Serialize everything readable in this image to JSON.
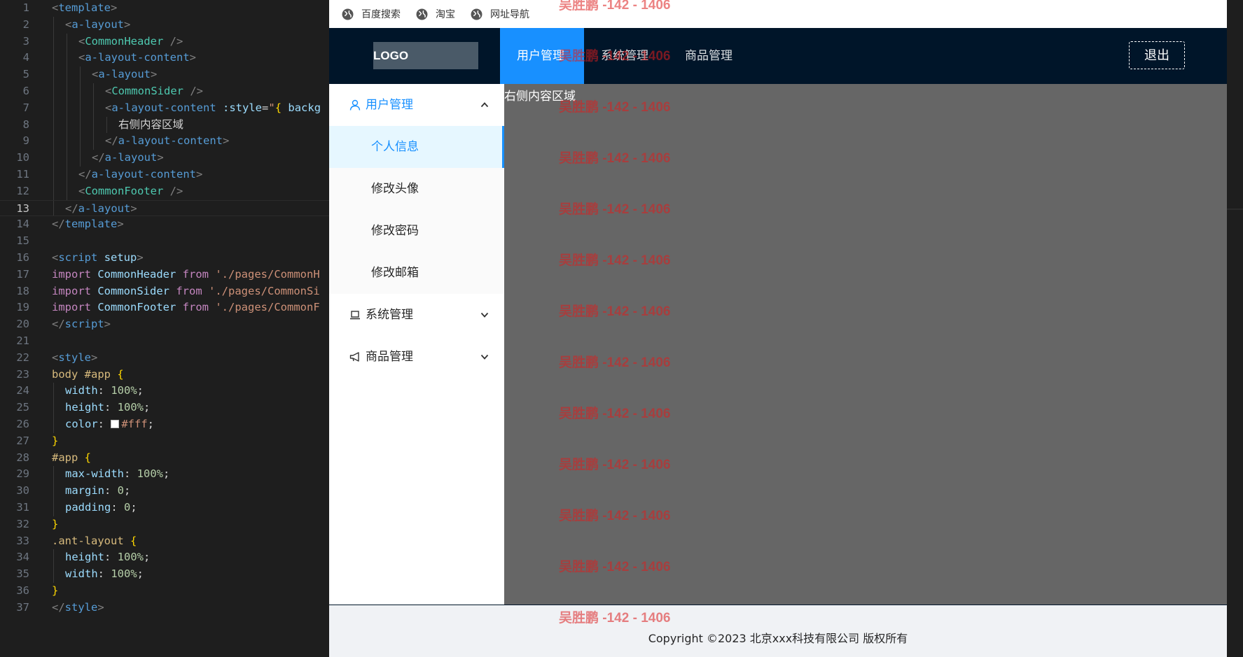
{
  "editor": {
    "lines": [
      {
        "n": "1",
        "indent": 0,
        "tokens": [
          [
            "t-pun",
            "<"
          ],
          [
            "t-tag",
            "template"
          ],
          [
            "t-pun",
            ">"
          ]
        ]
      },
      {
        "n": "2",
        "indent": 1,
        "tokens": [
          [
            "t-pun",
            "<"
          ],
          [
            "t-tag",
            "a-layout"
          ],
          [
            "t-pun",
            ">"
          ]
        ]
      },
      {
        "n": "3",
        "indent": 2,
        "tokens": [
          [
            "t-pun",
            "<"
          ],
          [
            "t-cmp",
            "CommonHeader"
          ],
          [
            "t-pln",
            " "
          ],
          [
            "t-pun",
            "/>"
          ]
        ]
      },
      {
        "n": "4",
        "indent": 2,
        "tokens": [
          [
            "t-pun",
            "<"
          ],
          [
            "t-tag",
            "a-layout-content"
          ],
          [
            "t-pun",
            ">"
          ]
        ]
      },
      {
        "n": "5",
        "indent": 3,
        "tokens": [
          [
            "t-pun",
            "<"
          ],
          [
            "t-tag",
            "a-layout"
          ],
          [
            "t-pun",
            ">"
          ]
        ]
      },
      {
        "n": "6",
        "indent": 4,
        "tokens": [
          [
            "t-pun",
            "<"
          ],
          [
            "t-cmp",
            "CommonSider"
          ],
          [
            "t-pln",
            " "
          ],
          [
            "t-pun",
            "/>"
          ]
        ]
      },
      {
        "n": "7",
        "indent": 4,
        "tokens": [
          [
            "t-pun",
            "<"
          ],
          [
            "t-tag",
            "a-layout-content"
          ],
          [
            "t-pln",
            " "
          ],
          [
            "t-att",
            ":style"
          ],
          [
            "t-pln",
            "="
          ],
          [
            "t-str",
            "\""
          ],
          [
            "t-brk",
            "{"
          ],
          [
            "t-pln",
            " "
          ],
          [
            "t-att",
            "backg"
          ]
        ]
      },
      {
        "n": "8",
        "indent": 5,
        "tokens": [
          [
            "t-txt",
            "右侧内容区域"
          ]
        ]
      },
      {
        "n": "9",
        "indent": 4,
        "tokens": [
          [
            "t-pun",
            "</"
          ],
          [
            "t-tag",
            "a-layout-content"
          ],
          [
            "t-pun",
            ">"
          ]
        ]
      },
      {
        "n": "10",
        "indent": 3,
        "tokens": [
          [
            "t-pun",
            "</"
          ],
          [
            "t-tag",
            "a-layout"
          ],
          [
            "t-pun",
            ">"
          ]
        ]
      },
      {
        "n": "11",
        "indent": 2,
        "tokens": [
          [
            "t-pun",
            "</"
          ],
          [
            "t-tag",
            "a-layout-content"
          ],
          [
            "t-pun",
            ">"
          ]
        ]
      },
      {
        "n": "12",
        "indent": 2,
        "tokens": [
          [
            "t-pun",
            "<"
          ],
          [
            "t-cmp",
            "CommonFooter"
          ],
          [
            "t-pln",
            " "
          ],
          [
            "t-pun",
            "/>"
          ]
        ]
      },
      {
        "n": "13",
        "indent": 1,
        "tokens": [
          [
            "t-pun",
            "</"
          ],
          [
            "t-tag",
            "a-layout"
          ],
          [
            "t-pun",
            ">"
          ]
        ]
      },
      {
        "n": "14",
        "indent": 0,
        "tokens": [
          [
            "t-pun",
            "</"
          ],
          [
            "t-tag",
            "template"
          ],
          [
            "t-pun",
            ">"
          ]
        ]
      },
      {
        "n": "15",
        "indent": 0,
        "tokens": []
      },
      {
        "n": "16",
        "indent": 0,
        "tokens": [
          [
            "t-pun",
            "<"
          ],
          [
            "t-tag",
            "script"
          ],
          [
            "t-pln",
            " "
          ],
          [
            "t-att",
            "setup"
          ],
          [
            "t-pun",
            ">"
          ]
        ]
      },
      {
        "n": "17",
        "indent": 0,
        "tokens": [
          [
            "t-kw",
            "import"
          ],
          [
            "t-pln",
            " "
          ],
          [
            "t-id",
            "CommonHeader"
          ],
          [
            "t-pln",
            " "
          ],
          [
            "t-kw",
            "from"
          ],
          [
            "t-pln",
            " "
          ],
          [
            "t-str",
            "'./pages/CommonH"
          ]
        ]
      },
      {
        "n": "18",
        "indent": 0,
        "tokens": [
          [
            "t-kw",
            "import"
          ],
          [
            "t-pln",
            " "
          ],
          [
            "t-id",
            "CommonSider"
          ],
          [
            "t-pln",
            " "
          ],
          [
            "t-kw",
            "from"
          ],
          [
            "t-pln",
            " "
          ],
          [
            "t-str",
            "'./pages/CommonSi"
          ]
        ]
      },
      {
        "n": "19",
        "indent": 0,
        "tokens": [
          [
            "t-kw",
            "import"
          ],
          [
            "t-pln",
            " "
          ],
          [
            "t-id",
            "CommonFooter"
          ],
          [
            "t-pln",
            " "
          ],
          [
            "t-kw",
            "from"
          ],
          [
            "t-pln",
            " "
          ],
          [
            "t-str",
            "'./pages/CommonF"
          ]
        ]
      },
      {
        "n": "20",
        "indent": 0,
        "tokens": [
          [
            "t-pun",
            "</"
          ],
          [
            "t-tag",
            "script"
          ],
          [
            "t-pun",
            ">"
          ]
        ]
      },
      {
        "n": "21",
        "indent": 0,
        "tokens": []
      },
      {
        "n": "22",
        "indent": 0,
        "tokens": [
          [
            "t-pun",
            "<"
          ],
          [
            "t-tag",
            "style"
          ],
          [
            "t-pun",
            ">"
          ]
        ]
      },
      {
        "n": "23",
        "indent": 0,
        "tokens": [
          [
            "t-sel",
            "body #app"
          ],
          [
            "t-pln",
            " "
          ],
          [
            "t-brk",
            "{"
          ]
        ]
      },
      {
        "n": "24",
        "indent": 1,
        "tokens": [
          [
            "t-prop",
            "width"
          ],
          [
            "t-pln",
            ": "
          ],
          [
            "t-num",
            "100%"
          ],
          [
            "t-pln",
            ";"
          ]
        ]
      },
      {
        "n": "25",
        "indent": 1,
        "tokens": [
          [
            "t-prop",
            "height"
          ],
          [
            "t-pln",
            ": "
          ],
          [
            "t-num",
            "100%"
          ],
          [
            "t-pln",
            ";"
          ]
        ]
      },
      {
        "n": "26",
        "indent": 1,
        "tokens": [
          [
            "t-prop",
            "color"
          ],
          [
            "t-pln",
            ": "
          ],
          [
            "swatch",
            ""
          ],
          [
            "t-str",
            "#fff"
          ],
          [
            "t-pln",
            ";"
          ]
        ]
      },
      {
        "n": "27",
        "indent": 0,
        "tokens": [
          [
            "t-brk",
            "}"
          ]
        ]
      },
      {
        "n": "28",
        "indent": 0,
        "tokens": [
          [
            "t-sel",
            "#app"
          ],
          [
            "t-pln",
            " "
          ],
          [
            "t-brk",
            "{"
          ]
        ]
      },
      {
        "n": "29",
        "indent": 1,
        "tokens": [
          [
            "t-prop",
            "max-width"
          ],
          [
            "t-pln",
            ": "
          ],
          [
            "t-num",
            "100%"
          ],
          [
            "t-pln",
            ";"
          ]
        ]
      },
      {
        "n": "30",
        "indent": 1,
        "tokens": [
          [
            "t-prop",
            "margin"
          ],
          [
            "t-pln",
            ": "
          ],
          [
            "t-num",
            "0"
          ],
          [
            "t-pln",
            ";"
          ]
        ]
      },
      {
        "n": "31",
        "indent": 1,
        "tokens": [
          [
            "t-prop",
            "padding"
          ],
          [
            "t-pln",
            ": "
          ],
          [
            "t-num",
            "0"
          ],
          [
            "t-pln",
            ";"
          ]
        ]
      },
      {
        "n": "32",
        "indent": 0,
        "tokens": [
          [
            "t-brk",
            "}"
          ]
        ]
      },
      {
        "n": "33",
        "indent": 0,
        "tokens": [
          [
            "t-sel",
            ".ant-layout"
          ],
          [
            "t-pln",
            " "
          ],
          [
            "t-brk",
            "{"
          ]
        ]
      },
      {
        "n": "34",
        "indent": 1,
        "tokens": [
          [
            "t-prop",
            "height"
          ],
          [
            "t-pln",
            ": "
          ],
          [
            "t-num",
            "100%"
          ],
          [
            "t-pln",
            ";"
          ]
        ]
      },
      {
        "n": "35",
        "indent": 1,
        "tokens": [
          [
            "t-prop",
            "width"
          ],
          [
            "t-pln",
            ": "
          ],
          [
            "t-num",
            "100%"
          ],
          [
            "t-pln",
            ";"
          ]
        ]
      },
      {
        "n": "36",
        "indent": 0,
        "tokens": [
          [
            "t-brk",
            "}"
          ]
        ]
      },
      {
        "n": "37",
        "indent": 0,
        "tokens": [
          [
            "t-pun",
            "</"
          ],
          [
            "t-tag",
            "style"
          ],
          [
            "t-pun",
            ">"
          ]
        ]
      }
    ],
    "current_line": "13"
  },
  "bookmarks": [
    {
      "label": "百度搜索",
      "icon": "globe-icon"
    },
    {
      "label": "淘宝",
      "icon": "globe-icon"
    },
    {
      "label": "网址导航",
      "icon": "globe-icon"
    }
  ],
  "header": {
    "logo": "LOGO",
    "nav": [
      "用户管理",
      "系统管理",
      "商品管理"
    ],
    "active_nav": "用户管理",
    "logout": "退出"
  },
  "sider": {
    "menus": [
      {
        "label": "用户管理",
        "icon": "user-icon",
        "expanded": true
      },
      {
        "label": "系统管理",
        "icon": "laptop-icon",
        "expanded": false
      },
      {
        "label": "商品管理",
        "icon": "notification-icon",
        "expanded": false
      }
    ],
    "submenu": [
      "个人信息",
      "修改头像",
      "修改密码",
      "修改邮箱"
    ],
    "selected": "个人信息"
  },
  "content": {
    "text": "右侧内容区域"
  },
  "footer": {
    "text": "Copyright ©2023 北京xxx科技有限公司 版权所有"
  },
  "watermark": "吴胜鹏 -142 - 1406",
  "colors": {
    "primary": "#1890ff",
    "header_bg": "#001529",
    "content_bg": "#666666",
    "footer_bg": "#f0f2f5",
    "watermark": "#dc1e1e"
  }
}
